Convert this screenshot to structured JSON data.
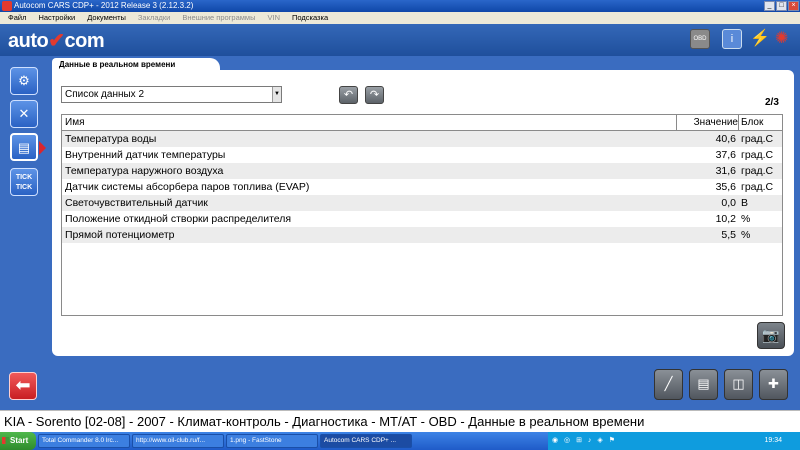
{
  "window": {
    "title": "Autocom CARS CDP+ - 2012 Release 3 (2.12.3.2)"
  },
  "menu": [
    {
      "label": "Файл",
      "enabled": true
    },
    {
      "label": "Настройки",
      "enabled": true
    },
    {
      "label": "Документы",
      "enabled": true
    },
    {
      "label": "Закладки",
      "enabled": false
    },
    {
      "label": "Внешние программы",
      "enabled": false
    },
    {
      "label": "VIN",
      "enabled": false
    },
    {
      "label": "Подсказка",
      "enabled": true
    }
  ],
  "header": {
    "logo_part1": "auto",
    "logo_accent": "✔",
    "logo_part2": "com",
    "obd_label": "OBD"
  },
  "sidebar": {
    "tick_label_1": "TICK",
    "tick_label_2": "TICK"
  },
  "tab": {
    "label": "Данные в реальном времени"
  },
  "list_select": {
    "value": "Список данных 2"
  },
  "pagination": {
    "label": "2/3"
  },
  "table": {
    "headers": {
      "name": "Имя",
      "value": "Значение",
      "unit": "Блок"
    },
    "rows": [
      {
        "name": "Температура воды",
        "value": "40,6",
        "unit": "град.С"
      },
      {
        "name": "Внутренний датчик температуры",
        "value": "37,6",
        "unit": "град.С"
      },
      {
        "name": "Температура наружного воздуха",
        "value": "31,6",
        "unit": "град.С"
      },
      {
        "name": "Датчик системы абсорбера паров топлива (EVAP)",
        "value": "35,6",
        "unit": "град.С"
      },
      {
        "name": "Светочувствительный датчик",
        "value": "0,0",
        "unit": "В"
      },
      {
        "name": "Положение откидной створки распределителя",
        "value": "10,2",
        "unit": "%"
      },
      {
        "name": "Прямой потенциометр",
        "value": "5,5",
        "unit": "%"
      }
    ]
  },
  "status_line": "KIA - Sorento [02-08] - 2007 - Климат-контроль - Диагностика - MT/AT - OBD - Данные в реальном времени",
  "taskbar": {
    "start_label": "Start",
    "tasks": [
      {
        "label": "Total Commander 8.0 lrc...",
        "active": false
      },
      {
        "label": "http://www.oil-club.ru/f...",
        "active": false
      },
      {
        "label": "1.png - FastStone",
        "active": false
      },
      {
        "label": "Autocom CARS CDP+ ...",
        "active": true
      }
    ],
    "clock": "19:34"
  },
  "colors": {
    "brand_blue": "#3a6cc0",
    "accent_red": "#d9262e"
  }
}
